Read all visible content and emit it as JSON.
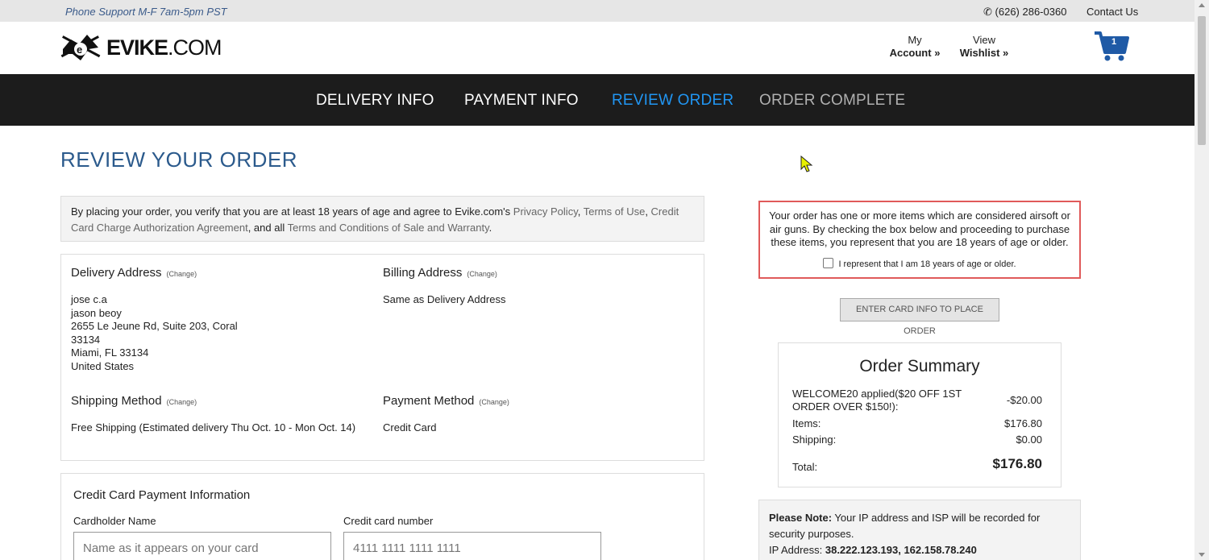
{
  "topbar": {
    "support": "Phone Support M-F 7am-5pm PST",
    "phone": "(626) 286-0360",
    "contact": "Contact Us"
  },
  "header": {
    "logo_brand": "EVIKE",
    "logo_suffix": ".COM",
    "account_line1": "My",
    "account_line2": "Account »",
    "wishlist_line1": "View",
    "wishlist_line2": "Wishlist »",
    "cart_count": "1"
  },
  "steps": [
    {
      "label": "DELIVERY INFO"
    },
    {
      "label": "PAYMENT INFO"
    },
    {
      "label": "REVIEW ORDER"
    },
    {
      "label": "ORDER COMPLETE"
    }
  ],
  "page_title": "REVIEW YOUR ORDER",
  "agreement": {
    "text_start": "By placing your order, you verify that you are at least 18 years of age and agree to Evike.com's ",
    "privacy": "Privacy Policy",
    "comma": ", ",
    "terms": "Terms of Use",
    "comma2": ", ",
    "cc_agreement": "Credit Card Charge Authorization Agreement",
    "and_all": ", and all ",
    "terms_sale": "Terms and Conditions of Sale and Warranty",
    "period": "."
  },
  "delivery": {
    "title": "Delivery Address",
    "change": "(Change)",
    "lines": [
      "jose c.a",
      "jason beoy",
      "2655 Le Jeune Rd, Suite 203, Coral",
      "33134",
      "Miami, FL 33134",
      "United States"
    ]
  },
  "billing": {
    "title": "Billing Address",
    "change": "(Change)",
    "value": "Same as Delivery Address"
  },
  "shipping": {
    "title": "Shipping Method",
    "change": "(Change)",
    "value": "Free Shipping (Estimated delivery Thu Oct. 10 - Mon Oct. 14)"
  },
  "payment": {
    "title": "Payment Method",
    "change": "(Change)",
    "value": "Credit Card"
  },
  "credit_card": {
    "title": "Credit Card Payment Information",
    "name_label": "Cardholder Name",
    "name_placeholder": "Name as it appears on your card",
    "number_label": "Credit card number",
    "number_placeholder": "4111 1111 1111 1111"
  },
  "warning": {
    "text": "Your order has one or more items which are considered airsoft or air guns. By checking the box below and proceeding to purchase these items, you represent that you are 18 years of age or older.",
    "checkbox_label": "I represent that I am 18 years of age or older.",
    "checked": false
  },
  "place_order_button": "ENTER CARD INFO TO PLACE ORDER",
  "summary": {
    "title": "Order Summary",
    "coupon_label": "WELCOME20 applied($20 OFF 1ST ORDER OVER $150!):",
    "coupon_value": "-$20.00",
    "items_label": "Items:",
    "items_value": "$176.80",
    "shipping_label": "Shipping:",
    "shipping_value": "$0.00",
    "total_label": "Total:",
    "total_value": "$176.80"
  },
  "note": {
    "bold": "Please Note:",
    "text": " Your IP address and ISP will be recorded for security purposes.",
    "ip_label": "IP Address: ",
    "ip_value": "38.222.123.193, 162.158.78.240"
  },
  "colors": {
    "nav_bg": "#1c1c1c",
    "active_step": "#2196f3",
    "title_blue": "#2b5a8c",
    "warning_border": "#e05a5a",
    "cart_blue": "#1f5aa6"
  }
}
